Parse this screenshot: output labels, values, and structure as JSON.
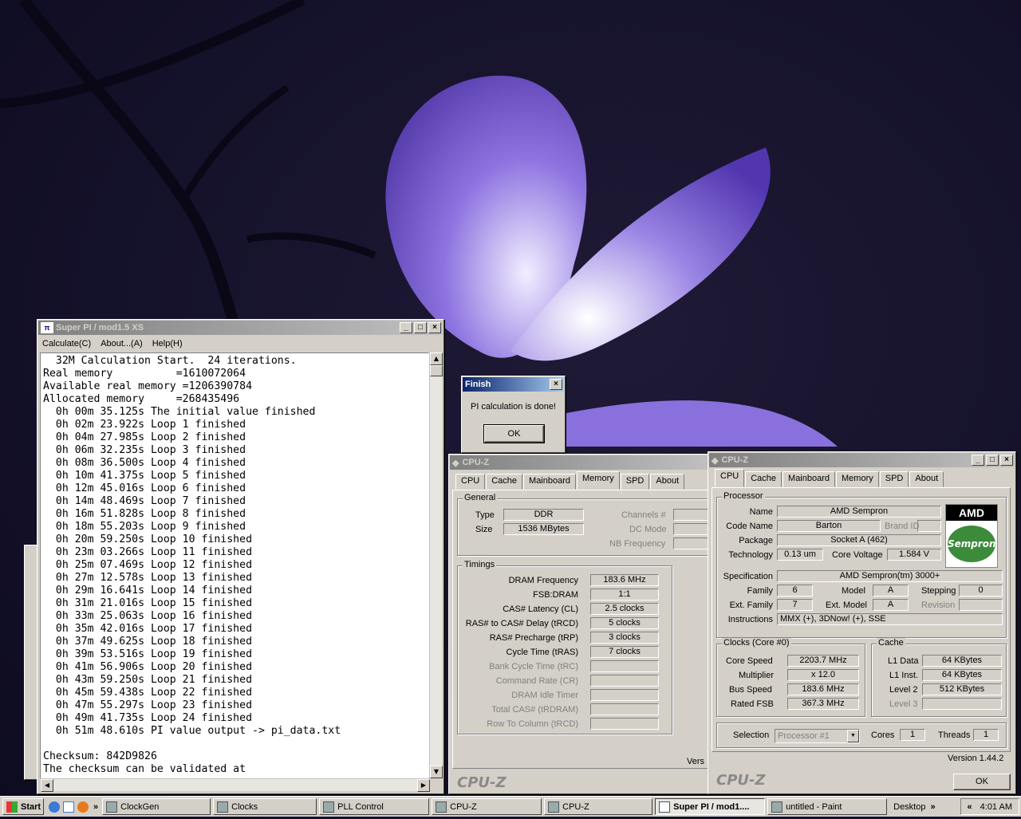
{
  "taskbar": {
    "start": "Start",
    "items": [
      {
        "label": "ClockGen",
        "pressed": false
      },
      {
        "label": "Clocks",
        "pressed": false
      },
      {
        "label": "PLL Control",
        "pressed": false
      },
      {
        "label": "CPU-Z",
        "pressed": false
      },
      {
        "label": "CPU-Z",
        "pressed": false
      },
      {
        "label": "Super PI / mod1....",
        "pressed": true
      },
      {
        "label": "untitled - Paint",
        "pressed": false
      }
    ],
    "desktop": "Desktop",
    "clock": "4:01 AM"
  },
  "superpi": {
    "title": "Super PI / mod1.5 XS",
    "menu": [
      "Calculate(C)",
      "About...(A)",
      "Help(H)"
    ],
    "lines": [
      "  32M Calculation Start.  24 iterations.",
      "Real memory          =1610072064",
      "Available real memory =1206390784",
      "Allocated memory     =268435496",
      "  0h 00m 35.125s The initial value finished",
      "  0h 02m 23.922s Loop 1 finished",
      "  0h 04m 27.985s Loop 2 finished",
      "  0h 06m 32.235s Loop 3 finished",
      "  0h 08m 36.500s Loop 4 finished",
      "  0h 10m 41.375s Loop 5 finished",
      "  0h 12m 45.016s Loop 6 finished",
      "  0h 14m 48.469s Loop 7 finished",
      "  0h 16m 51.828s Loop 8 finished",
      "  0h 18m 55.203s Loop 9 finished",
      "  0h 20m 59.250s Loop 10 finished",
      "  0h 23m 03.266s Loop 11 finished",
      "  0h 25m 07.469s Loop 12 finished",
      "  0h 27m 12.578s Loop 13 finished",
      "  0h 29m 16.641s Loop 14 finished",
      "  0h 31m 21.016s Loop 15 finished",
      "  0h 33m 25.063s Loop 16 finished",
      "  0h 35m 42.016s Loop 17 finished",
      "  0h 37m 49.625s Loop 18 finished",
      "  0h 39m 53.516s Loop 19 finished",
      "  0h 41m 56.906s Loop 20 finished",
      "  0h 43m 59.250s Loop 21 finished",
      "  0h 45m 59.438s Loop 22 finished",
      "  0h 47m 55.297s Loop 23 finished",
      "  0h 49m 41.735s Loop 24 finished",
      "  0h 51m 48.610s PI value output -> pi_data.txt",
      "",
      "Checksum: 842D9826",
      "The checksum can be validated at"
    ]
  },
  "finish": {
    "title": "Finish",
    "message": "PI calculation is done!",
    "ok": "OK"
  },
  "cpuz_mem": {
    "title": "CPU-Z",
    "tabs": [
      "CPU",
      "Cache",
      "Mainboard",
      "Memory",
      "SPD",
      "About"
    ],
    "general_label": "General",
    "type_label": "Type",
    "type": "DDR",
    "size_label": "Size",
    "size": "1536 MBytes",
    "channels_label": "Channels #",
    "dcmode_label": "DC Mode",
    "nbfreq_label": "NB Frequency",
    "timings_label": "Timings",
    "timings": [
      {
        "label": "DRAM Frequency",
        "value": "183.6 MHz",
        "enabled": true
      },
      {
        "label": "FSB:DRAM",
        "value": "1:1",
        "enabled": true
      },
      {
        "label": "CAS# Latency (CL)",
        "value": "2.5 clocks",
        "enabled": true
      },
      {
        "label": "RAS# to CAS# Delay (tRCD)",
        "value": "5 clocks",
        "enabled": true
      },
      {
        "label": "RAS# Precharge (tRP)",
        "value": "3 clocks",
        "enabled": true
      },
      {
        "label": "Cycle Time (tRAS)",
        "value": "7 clocks",
        "enabled": true
      },
      {
        "label": "Bank Cycle Time (tRC)",
        "value": "",
        "enabled": false
      },
      {
        "label": "Command Rate (CR)",
        "value": "",
        "enabled": false
      },
      {
        "label": "DRAM Idle Timer",
        "value": "",
        "enabled": false
      },
      {
        "label": "Total CAS# (tRDRAM)",
        "value": "",
        "enabled": false
      },
      {
        "label": "Row To Column (tRCD)",
        "value": "",
        "enabled": false
      }
    ],
    "version": "Vers",
    "logo": "CPU-Z"
  },
  "cpuz_cpu": {
    "title": "CPU-Z",
    "tabs": [
      "CPU",
      "Cache",
      "Mainboard",
      "Memory",
      "SPD",
      "About"
    ],
    "processor_label": "Processor",
    "name_label": "Name",
    "name": "AMD Sempron",
    "codename_label": "Code Name",
    "codename": "Barton",
    "brandid_label": "Brand ID",
    "package_label": "Package",
    "package": "Socket A (462)",
    "tech_label": "Technology",
    "tech": "0.13 um",
    "voltage_label": "Core Voltage",
    "voltage": "1.584 V",
    "spec_label": "Specification",
    "spec": "AMD Sempron(tm)   3000+",
    "family_label": "Family",
    "family": "6",
    "model_label": "Model",
    "model": "A",
    "stepping_label": "Stepping",
    "stepping": "0",
    "extfamily_label": "Ext. Family",
    "extfamily": "7",
    "extmodel_label": "Ext. Model",
    "extmodel": "A",
    "revision_label": "Revision",
    "instr_label": "Instructions",
    "instr": "MMX (+), 3DNow! (+), SSE",
    "clocks_label": "Clocks (Core #0)",
    "corespeed_label": "Core Speed",
    "corespeed": "2203.7 MHz",
    "mult_label": "Multiplier",
    "mult": "x 12.0",
    "bus_label": "Bus Speed",
    "bus": "183.6 MHz",
    "fsb_label": "Rated FSB",
    "fsb": "367.3 MHz",
    "cache_label": "Cache",
    "l1d_label": "L1 Data",
    "l1d": "64 KBytes",
    "l1i_label": "L1 Inst.",
    "l1i": "64 KBytes",
    "l2_label": "Level 2",
    "l2": "512 KBytes",
    "l3_label": "Level 3",
    "selection_label": "Selection",
    "selection": "Processor #1",
    "cores_label": "Cores",
    "cores": "1",
    "threads_label": "Threads",
    "threads": "1",
    "version": "Version 1.44.2",
    "ok": "OK",
    "logo": "CPU-Z",
    "amd_logo": "AMD",
    "sempron_logo": "Sempron"
  },
  "colors": {
    "titlebar": "#0a246a",
    "face": "#d4d0c8",
    "desktop": "#14112a",
    "petal": "#7a5cd0"
  }
}
